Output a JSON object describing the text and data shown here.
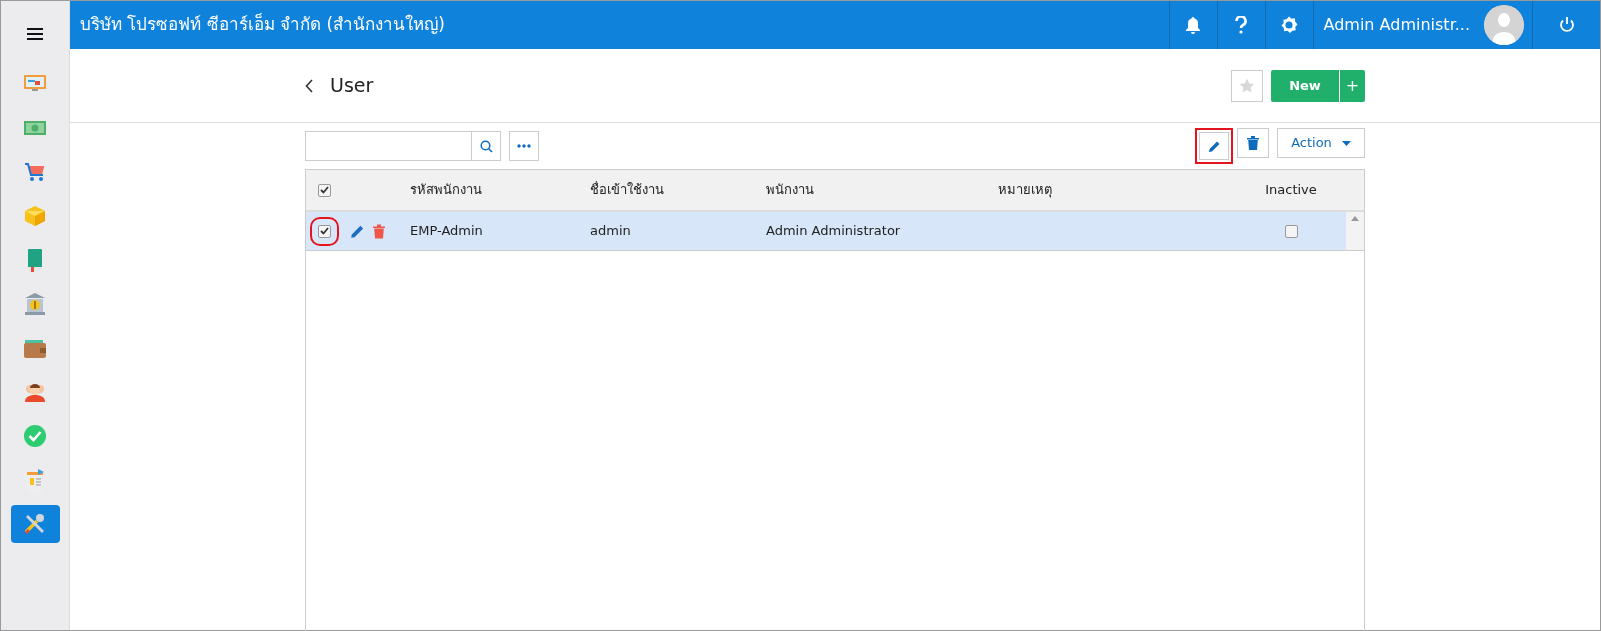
{
  "topbar": {
    "company": "บริษัท โปรซอฟท์ ซีอาร์เอ็ม จำกัด (สำนักงานใหญ่)",
    "user_name": "Admin Administr..."
  },
  "sidebar": {
    "items": [
      {
        "selected": false
      },
      {
        "selected": false
      },
      {
        "selected": false
      },
      {
        "selected": false
      },
      {
        "selected": false
      },
      {
        "selected": false
      },
      {
        "selected": false
      },
      {
        "selected": false
      },
      {
        "selected": false
      },
      {
        "selected": false
      },
      {
        "selected": true
      }
    ]
  },
  "page": {
    "title": "User",
    "favorite": false,
    "new_button": "New",
    "new_plus": "+"
  },
  "toolbar": {
    "edit_highlighted": true,
    "action_button": "Action"
  },
  "table": {
    "all_checked": true,
    "columns": [
      "รหัสพนักงาน",
      "ชื่อเข้าใช้งาน",
      "พนักงาน",
      "หมายเหตุ",
      "Inactive"
    ],
    "rows": [
      {
        "selected": true,
        "checked": true,
        "checkbox_highlighted": true,
        "code": "EMP-Admin",
        "username": "admin",
        "employee": "Admin Administrator",
        "inactive": false
      }
    ]
  }
}
